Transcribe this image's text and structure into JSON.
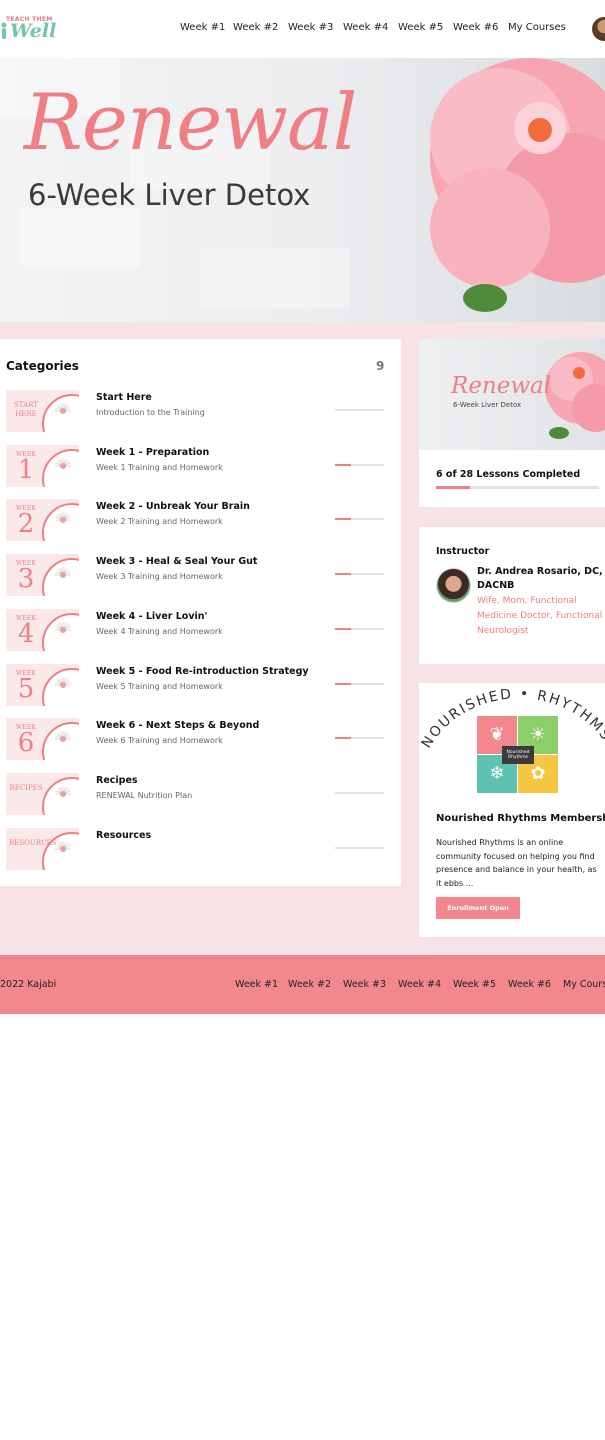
{
  "brand": {
    "logo_small": "TEACH THEM",
    "logo_big": "Well"
  },
  "nav": [
    "Week #1",
    "Week #2",
    "Week #3",
    "Week #4",
    "Week #5",
    "Week #6",
    "My Courses"
  ],
  "hero": {
    "title": "Renewal",
    "subtitle": "6-Week Liver Detox"
  },
  "categories": {
    "title": "Categories",
    "count": "9",
    "items": [
      {
        "thumb_word": "START HERE",
        "thumb_num": "",
        "name": "Start Here",
        "desc": "Introduction to the Training",
        "progress": 0
      },
      {
        "thumb_word": "WEEK",
        "thumb_num": "1",
        "name": "Week 1 - Preparation",
        "desc": "Week 1 Training and Homework",
        "progress": 0.33
      },
      {
        "thumb_word": "WEEK",
        "thumb_num": "2",
        "name": "Week 2 - Unbreak Your Brain",
        "desc": "Week 2 Training and Homework",
        "progress": 0.33
      },
      {
        "thumb_word": "WEEK",
        "thumb_num": "3",
        "name": "Week 3 - Heal & Seal Your Gut",
        "desc": "Week 3 Training and Homework",
        "progress": 0.33
      },
      {
        "thumb_word": "WEEK",
        "thumb_num": "4",
        "name": "Week 4 - Liver Lovin'",
        "desc": "Week 4 Training and Homework",
        "progress": 0.33
      },
      {
        "thumb_word": "WEEK",
        "thumb_num": "5",
        "name": "Week 5 - Food Re-introduction Strategy",
        "desc": "Week 5 Training and Homework",
        "progress": 0.33
      },
      {
        "thumb_word": "WEEK",
        "thumb_num": "6",
        "name": "Week 6 - Next Steps & Beyond",
        "desc": "Week 6 Training and Homework",
        "progress": 0.33
      },
      {
        "thumb_word": "RECIPES",
        "thumb_num": "",
        "name": "Recipes",
        "desc": "RENEWAL Nutrition Plan",
        "progress": 0
      },
      {
        "thumb_word": "RESOURCES",
        "thumb_num": "",
        "name": "Resources",
        "desc": "",
        "progress": 0
      }
    ]
  },
  "course_card": {
    "image_title": "Renewal",
    "image_subtitle": "6-Week Liver Detox",
    "progress_label": "6 of 28 Lessons Completed",
    "progress": 0.21
  },
  "instructor": {
    "heading": "Instructor",
    "name": "Dr. Andrea Rosario, DC, DACNB",
    "bio": "Wife, Mom, Functional Medicine Doctor, Functional Neurologist"
  },
  "membership": {
    "arc_text": "NOURISHED • RHYTHMS",
    "center_text": "Nourished Rhythms",
    "title": "Nourished Rhythms Membership",
    "text": "Nourished Rhythms is an online community focused on helping you find presence and balance in your health, as it ebbs ...",
    "button": "Enrollment Open"
  },
  "footer": {
    "copyright": "2022 Kajabi",
    "nav": [
      "Week #1",
      "Week #2",
      "Week #3",
      "Week #4",
      "Week #5",
      "Week #6",
      "My Courses"
    ]
  },
  "colors": {
    "accent": "#ef7f84",
    "band": "#f7e3e5",
    "footer": "#f2888d",
    "logo_green": "#74c6a8"
  }
}
